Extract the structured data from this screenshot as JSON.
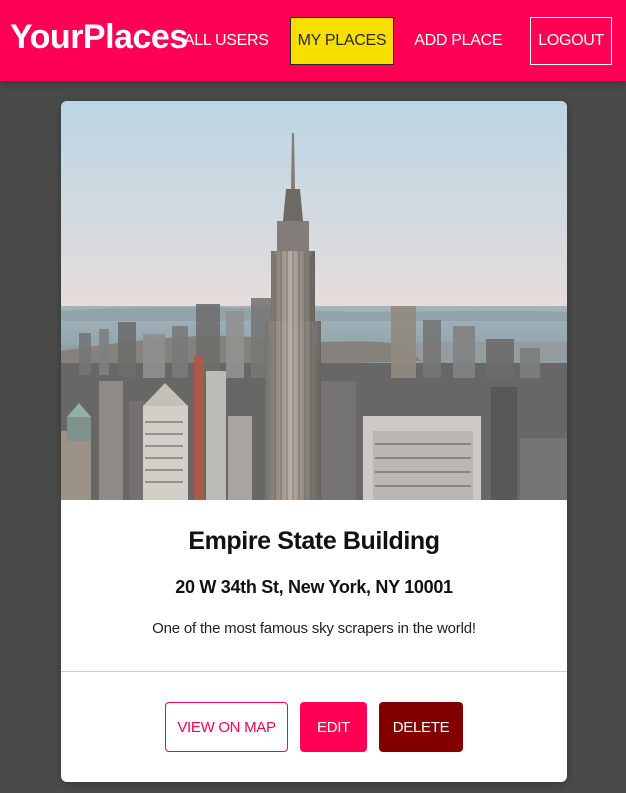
{
  "header": {
    "brand": "YourPlaces",
    "nav": {
      "all_users": "ALL USERS",
      "my_places": "MY PLACES",
      "add_place": "ADD PLACE",
      "logout": "LOGOUT"
    },
    "active_item": "my_places"
  },
  "place": {
    "image_alt": "Empire State Building skyline photo",
    "title": "Empire State Building",
    "address": "20 W 34th St, New York, NY 10001",
    "description": "One of the most famous sky scrapers in the world!"
  },
  "actions": {
    "view_on_map": "VIEW ON MAP",
    "edit": "EDIT",
    "delete": "DELETE"
  },
  "colors": {
    "brand": "#ff0055",
    "active_nav": "#f8df00",
    "danger": "#830000",
    "background": "#4a4a4a"
  }
}
